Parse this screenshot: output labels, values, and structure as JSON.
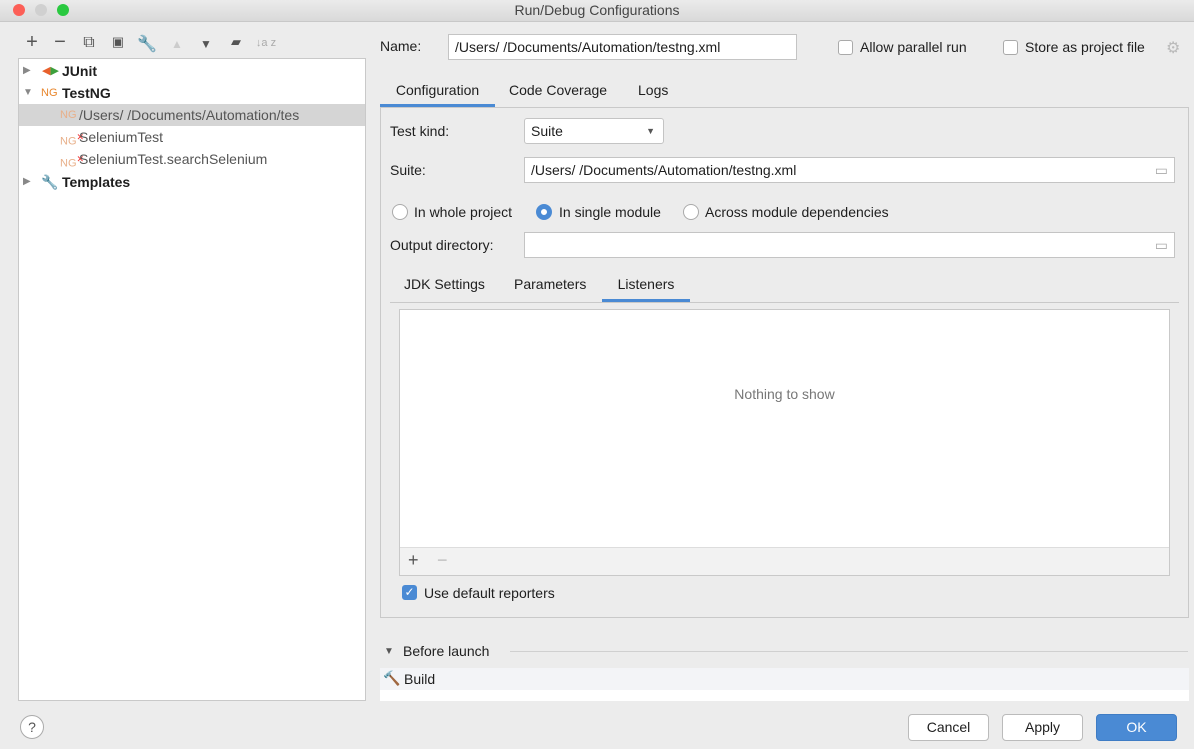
{
  "window": {
    "title": "Run/Debug Configurations"
  },
  "toolbar": {
    "add": "+",
    "remove": "−",
    "copy": "⧉",
    "save": "💾",
    "edit": "🔧",
    "up": "▲",
    "down": "▼",
    "folder": "📁",
    "sort": "↓a z"
  },
  "tree": {
    "junit": "JUnit",
    "testng": "TestNG",
    "config": "/Users/        /Documents/Automation/tes",
    "selenium": "SeleniumTest",
    "search": "SeleniumTest.searchSelenium",
    "templates": "Templates"
  },
  "name": {
    "label": "Name:",
    "value": "/Users/        /Documents/Automation/testng.xml",
    "parallel": "Allow parallel run",
    "store": "Store as project file"
  },
  "tabs": [
    "Configuration",
    "Code Coverage",
    "Logs"
  ],
  "config": {
    "test_kind_label": "Test kind:",
    "test_kind_value": "Suite",
    "suite_label": "Suite:",
    "suite_value": "/Users/        /Documents/Automation/testng.xml",
    "radio": [
      "In whole project",
      "In single module",
      "Across module dependencies"
    ],
    "output_label": "Output directory:",
    "output_value": ""
  },
  "subtabs": [
    "JDK Settings",
    "Parameters",
    "Listeners"
  ],
  "listeners": {
    "empty": "Nothing to show",
    "add": "+",
    "remove": "−"
  },
  "reporters": "Use default reporters",
  "before_launch": {
    "label": "Before launch",
    "item": "Build"
  },
  "buttons": {
    "help": "?",
    "cancel": "Cancel",
    "apply": "Apply",
    "ok": "OK"
  },
  "colors": {
    "accent": "#4a8ad4",
    "selection": "#d5d5d5"
  }
}
